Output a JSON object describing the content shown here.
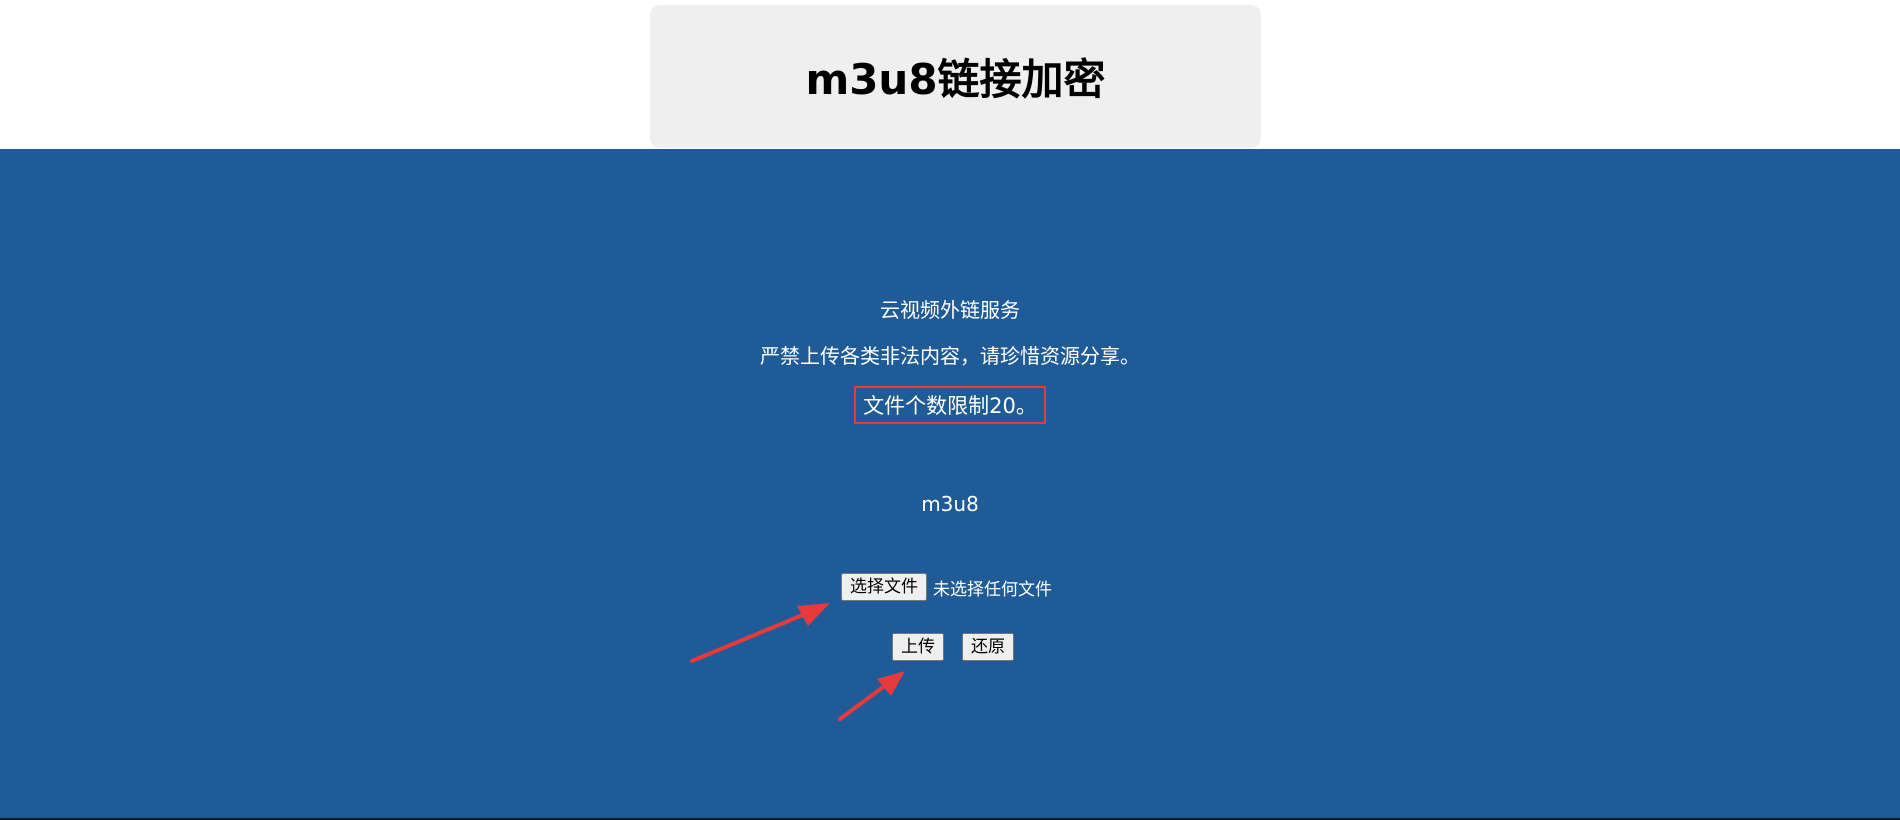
{
  "header": {
    "title": "m3u8链接加密"
  },
  "notices": {
    "service": "云视频外链服务",
    "warning": "严禁上传各类非法内容，请珍惜资源分享。",
    "limit": "文件个数限制20。"
  },
  "uploader": {
    "section_label": "m3u8",
    "choose_file_label": "选择文件",
    "file_status": "未选择任何文件",
    "upload_label": "上传",
    "reset_label": "还原"
  },
  "colors": {
    "main_background": "#1f5b96",
    "title_card_background": "#efefef",
    "highlight_border": "#e83a3a",
    "arrow": "#e83a3a"
  }
}
